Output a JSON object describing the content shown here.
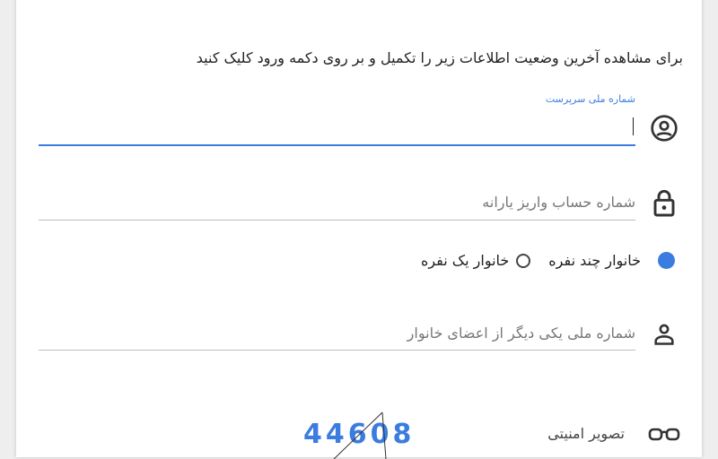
{
  "intro_text": "برای مشاهده آخرین وضعیت اطلاعات زیر را تکمیل و بر روی دکمه ورود کلیک کنید",
  "guardian_field": {
    "label": "شماره ملی سرپرست",
    "value": "",
    "icon": "account-circle-icon"
  },
  "account_field": {
    "placeholder": "شماره حساب واریز یارانه",
    "value": "",
    "icon": "lock-icon"
  },
  "household_type": {
    "options": [
      {
        "label": "خانوار چند نفره",
        "checked": true
      },
      {
        "label": "خانوار یک نفره",
        "checked": false
      }
    ]
  },
  "member_field": {
    "placeholder": "شماره ملی یکی دیگر از اعضای خانوار",
    "value": "",
    "icon": "person-icon"
  },
  "captcha": {
    "label": "تصویر امنیتی",
    "icon": "glasses-icon",
    "text": "44608"
  },
  "colors": {
    "accent": "#3b7ce0",
    "text": "#222222",
    "placeholder": "#777777",
    "underline": "#bdbdbd"
  }
}
